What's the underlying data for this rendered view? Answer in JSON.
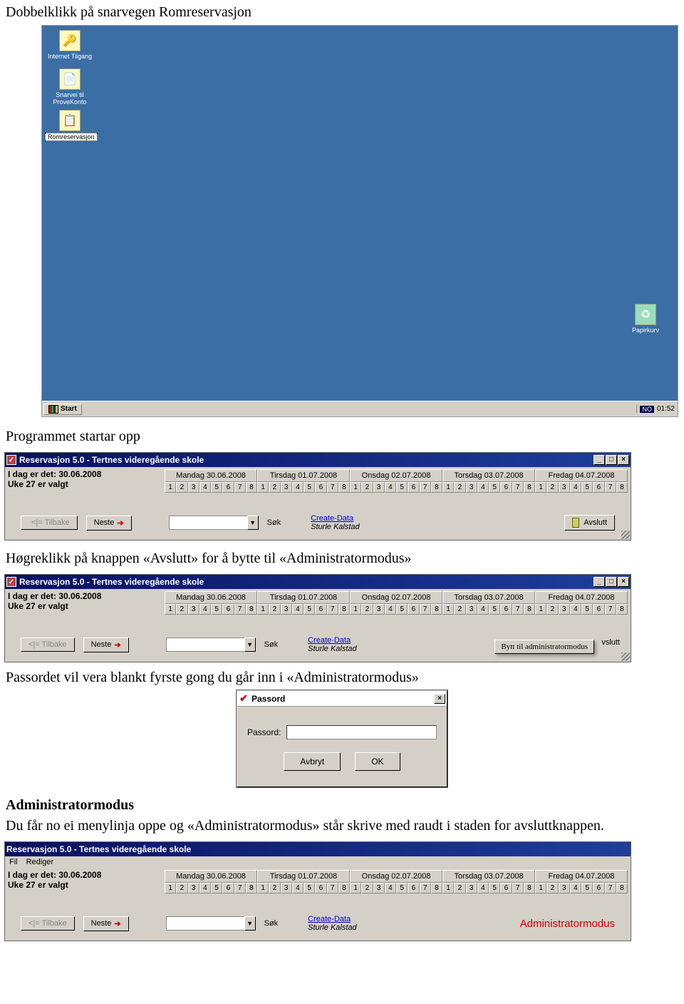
{
  "doc": {
    "p1": "Dobbelklikk på snarvegen Romreservasjon",
    "p2": "Programmet startar opp",
    "p3": "Høgreklikk på knappen «Avslutt» for å  bytte til «Administratormodus»",
    "p4": "Passordet vil vera blankt fyrste gong du går inn i «Administratormodus»",
    "h_admin": "Administratormodus",
    "p5": "Du får no ei menylinja oppe og «Administratormodus» står skrive med raudt i staden for avsluttknappen."
  },
  "desktop": {
    "icons": [
      {
        "label": "Internet Tilgang"
      },
      {
        "label": "Snarvei til ProveKonto"
      },
      {
        "label": "Romreservasjon",
        "selected": true
      }
    ],
    "recycle": "Papirkurv",
    "start": "Start",
    "lang": "NO",
    "clock": "01:52"
  },
  "win": {
    "title": "Reservasjon 5.0 - Tertnes videregående skole",
    "date_label": "I dag er det: 30.06.2008",
    "week_label": "Uke 27 er valgt",
    "days": [
      "Mandag 30.06.2008",
      "Tirsdag 01.07.2008",
      "Onsdag 02.07.2008",
      "Torsdag 03.07.2008",
      "Fredag 04.07.2008"
    ],
    "nums": [
      "1",
      "2",
      "3",
      "4",
      "5",
      "6",
      "7",
      "8"
    ],
    "btn_tilbake": "<|= Tilbake",
    "btn_neste": "Neste",
    "btn_sok": "Søk",
    "center_link": "Create-Data",
    "center_author": "Sturle Kalstad",
    "btn_avslutt": "Avslutt",
    "context_item": "Bytt til administratormodus",
    "adminmode": "Administratormodus",
    "menu_fil": "Fil",
    "menu_rediger": "Rediger"
  },
  "dialog": {
    "title": "Passord",
    "label": "Passord:",
    "placeholder": "",
    "btn_cancel": "Avbryt",
    "btn_ok": "OK"
  }
}
